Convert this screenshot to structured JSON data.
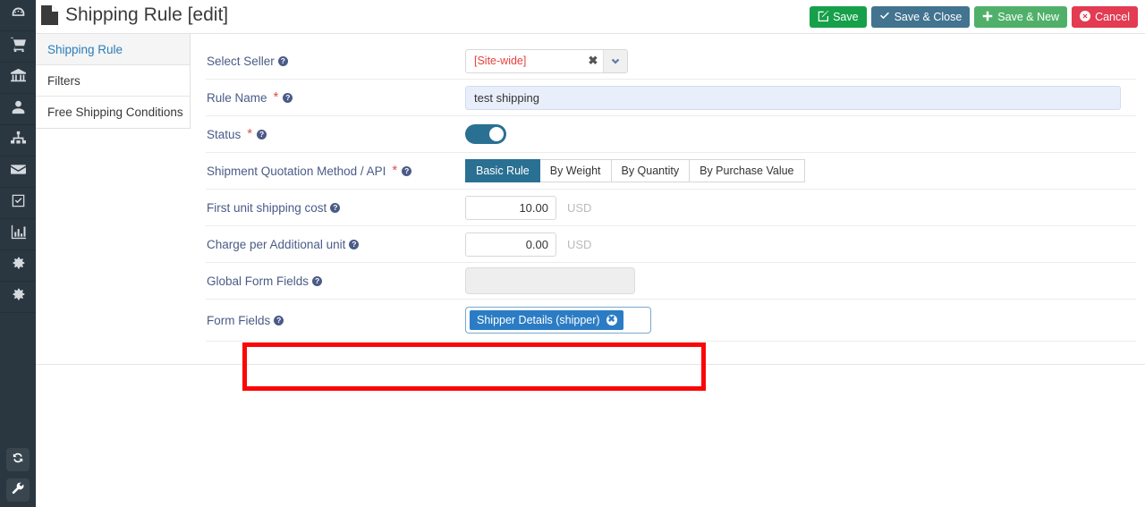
{
  "rail": {
    "items": [
      {
        "icon": "dashboard-icon"
      },
      {
        "icon": "cart-icon"
      },
      {
        "icon": "bank-icon"
      },
      {
        "icon": "user-icon"
      },
      {
        "icon": "sitemap-icon"
      },
      {
        "icon": "envelope-icon"
      },
      {
        "icon": "check-square-icon"
      },
      {
        "icon": "bar-chart-icon"
      },
      {
        "icon": "gear-icon"
      },
      {
        "icon": "gear-alt-icon"
      }
    ],
    "bottom": [
      {
        "icon": "refresh-icon"
      },
      {
        "icon": "wrench-icon"
      }
    ]
  },
  "header": {
    "title": "Shipping Rule [edit]",
    "doc_icon": "file-icon",
    "buttons": [
      {
        "label": "Save",
        "icon": "edit-icon",
        "color": "#16a04a"
      },
      {
        "label": "Save & Close",
        "icon": "check-icon",
        "color": "#42738f"
      },
      {
        "label": "Save & New",
        "icon": "plus-icon",
        "color": "#50b06a"
      },
      {
        "label": "Cancel",
        "icon": "times-circle-icon",
        "color": "#e23b52"
      }
    ]
  },
  "submenu": {
    "items": [
      {
        "label": "Shipping Rule",
        "active": true
      },
      {
        "label": "Filters",
        "active": false
      },
      {
        "label": "Free Shipping Conditions",
        "active": false
      }
    ]
  },
  "form": {
    "select_seller": {
      "label": "Select Seller",
      "value": "[Site-wide]",
      "clear_icon": "times-icon",
      "arrow_icon": "chevron-down-icon"
    },
    "rule_name": {
      "label": "Rule Name",
      "value": "test shipping",
      "required": "*"
    },
    "status": {
      "label": "Status",
      "required": "*",
      "on": true
    },
    "quotation_method": {
      "label": "Shipment Quotation Method / API",
      "required": "*",
      "options": [
        {
          "label": "Basic Rule",
          "selected": true
        },
        {
          "label": "By Weight",
          "selected": false
        },
        {
          "label": "By Quantity",
          "selected": false
        },
        {
          "label": "By Purchase Value",
          "selected": false
        }
      ]
    },
    "first_unit_cost": {
      "label": "First unit shipping cost",
      "value": "10.00",
      "unit": "USD"
    },
    "additional_unit_cost": {
      "label": "Charge per Additional unit",
      "value": "0.00",
      "unit": "USD"
    },
    "global_form_fields": {
      "label": "Global Form Fields",
      "value": ""
    },
    "form_fields": {
      "label": "Form Fields",
      "tags": [
        {
          "label": "Shipper Details (shipper)",
          "remove_icon": "times-circle-icon"
        }
      ]
    },
    "help_icon": "question-circle-icon"
  },
  "annotation": {
    "color": "#fb0606"
  }
}
